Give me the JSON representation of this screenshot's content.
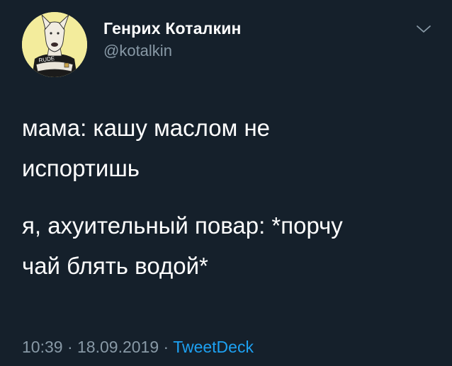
{
  "author": {
    "display_name": "Генрих Коталкин",
    "handle": "@kotalkin",
    "avatar_text": "RUDE"
  },
  "tweet": {
    "lines": [
      [
        "мама: кашу маслом не",
        "испортишь"
      ],
      [
        "я, ахуительный повар: *порчу",
        "чай блять водой*"
      ]
    ]
  },
  "meta": {
    "time": "10:39",
    "separator": "·",
    "date": "18.09.2019",
    "source": "TweetDeck"
  },
  "icons": {
    "menu": "chevron-down-icon"
  },
  "colors": {
    "background": "#15202b",
    "text": "#ffffff",
    "secondary": "#8899a6",
    "link": "#1da1f2",
    "avatar_bg": "#f3ec9c"
  }
}
